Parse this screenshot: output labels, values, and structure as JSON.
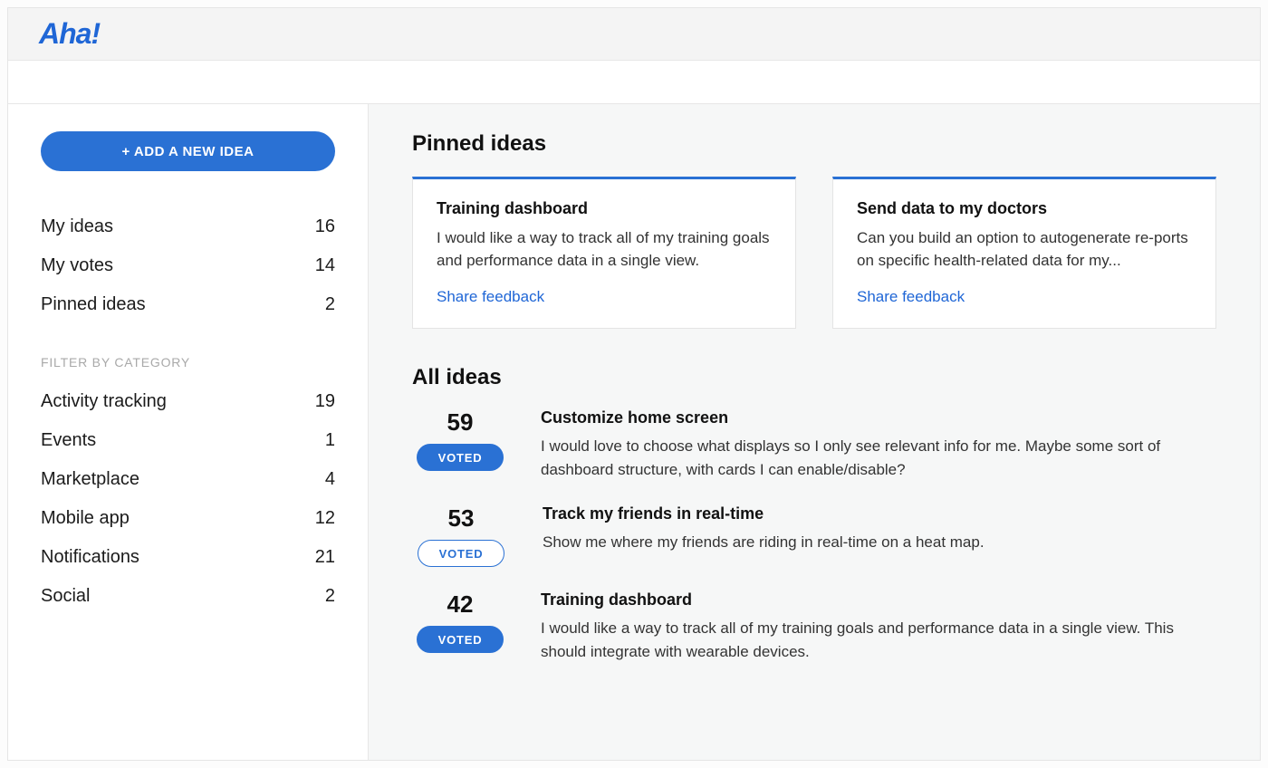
{
  "brand": {
    "logo": "Aha!"
  },
  "sidebar": {
    "add_button": "+ ADD A NEW IDEA",
    "nav": [
      {
        "label": "My ideas",
        "count": "16"
      },
      {
        "label": "My votes",
        "count": "14"
      },
      {
        "label": "Pinned ideas",
        "count": "2"
      }
    ],
    "filter_heading": "FILTER BY CATEGORY",
    "categories": [
      {
        "label": "Activity tracking",
        "count": "19"
      },
      {
        "label": "Events",
        "count": "1"
      },
      {
        "label": "Marketplace",
        "count": "4"
      },
      {
        "label": "Mobile app",
        "count": "12"
      },
      {
        "label": "Notifications",
        "count": "21"
      },
      {
        "label": "Social",
        "count": "2"
      }
    ]
  },
  "main": {
    "pinned_heading": "Pinned ideas",
    "pinned": [
      {
        "title": "Training dashboard",
        "desc": "I would like a way to track all of my training goals and performance data in a single view.",
        "link": "Share feedback"
      },
      {
        "title": "Send data to my doctors",
        "desc": "Can you build an option to autogenerate re‑ports on specific health-related data for my...",
        "link": "Share feedback"
      }
    ],
    "all_heading": "All ideas",
    "ideas": [
      {
        "votes": "59",
        "vote_label": "VOTED",
        "vote_style": "filled",
        "title": "Customize home screen",
        "desc": "I would love to choose what displays so I only see relevant info for me. Maybe some sort of dashboard structure, with cards I can enable/disable?"
      },
      {
        "votes": "53",
        "vote_label": "VOTED",
        "vote_style": "outline",
        "title": "Track my friends in real-time",
        "desc": "Show me where my friends are riding in real-time on a heat map."
      },
      {
        "votes": "42",
        "vote_label": "VOTED",
        "vote_style": "filled",
        "title": "Training dashboard",
        "desc": "I would like a way to track all of my training goals and performance data in a single view. This should integrate with wearable devices."
      }
    ]
  }
}
